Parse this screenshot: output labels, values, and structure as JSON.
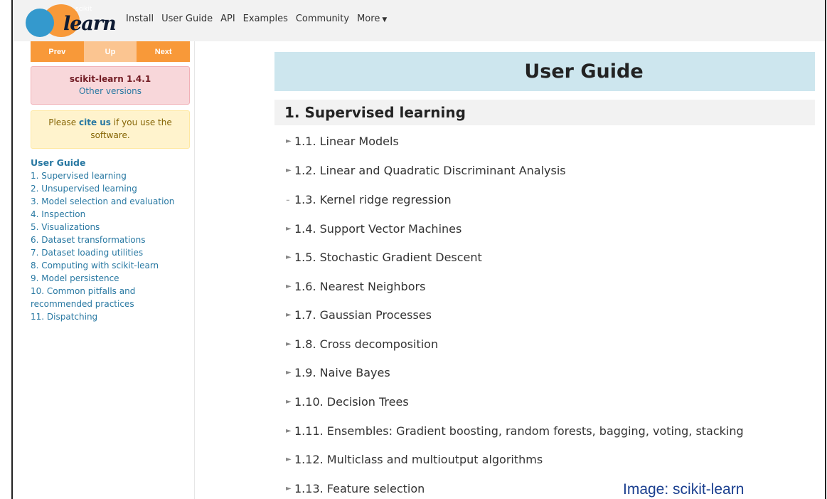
{
  "navbar": {
    "logo_small": "scikit",
    "logo_large": "learn",
    "links": [
      "Install",
      "User Guide",
      "API",
      "Examples",
      "Community",
      "More"
    ]
  },
  "sidebar": {
    "nav_buttons": {
      "prev": "Prev",
      "up": "Up",
      "next": "Next"
    },
    "version": "scikit-learn 1.4.1",
    "other_versions": "Other versions",
    "cite_prefix": "Please ",
    "cite_link": "cite us",
    "cite_suffix": " if you use the software.",
    "toc_heading": "User Guide",
    "toc_items": [
      "1. Supervised learning",
      "2. Unsupervised learning",
      "3. Model selection and evaluation",
      "4. Inspection",
      "5. Visualizations",
      "6. Dataset transformations",
      "7. Dataset loading utilities",
      "8. Computing with scikit-learn",
      "9. Model persistence",
      "10. Common pitfalls and",
      "recommended practices",
      "11. Dispatching"
    ]
  },
  "main": {
    "page_title": "User Guide",
    "section_title": "1. Supervised learning",
    "items": [
      {
        "text": "1.1. Linear Models",
        "marker": "arrow"
      },
      {
        "text": "1.2. Linear and Quadratic Discriminant Analysis",
        "marker": "arrow"
      },
      {
        "text": "1.3. Kernel ridge regression",
        "marker": "dash"
      },
      {
        "text": "1.4. Support Vector Machines",
        "marker": "arrow"
      },
      {
        "text": "1.5. Stochastic Gradient Descent",
        "marker": "arrow"
      },
      {
        "text": "1.6. Nearest Neighbors",
        "marker": "arrow"
      },
      {
        "text": "1.7. Gaussian Processes",
        "marker": "arrow"
      },
      {
        "text": "1.8. Cross decomposition",
        "marker": "arrow"
      },
      {
        "text": "1.9. Naive Bayes",
        "marker": "arrow"
      },
      {
        "text": "1.10. Decision Trees",
        "marker": "arrow"
      },
      {
        "text": "1.11. Ensembles: Gradient boosting, random forests, bagging, voting, stacking",
        "marker": "arrow"
      },
      {
        "text": "1.12. Multiclass and multioutput algorithms",
        "marker": "arrow"
      },
      {
        "text": "1.13. Feature selection",
        "marker": "arrow"
      }
    ]
  },
  "credit": "Image: scikit-learn",
  "colors": {
    "accent_orange": "#f89939",
    "accent_blue": "#3499cd",
    "link": "#2878a2",
    "title_bar": "#cde6ee"
  },
  "icons": {
    "arrow": "right-arrow-icon",
    "caret": "caret-down-icon"
  }
}
